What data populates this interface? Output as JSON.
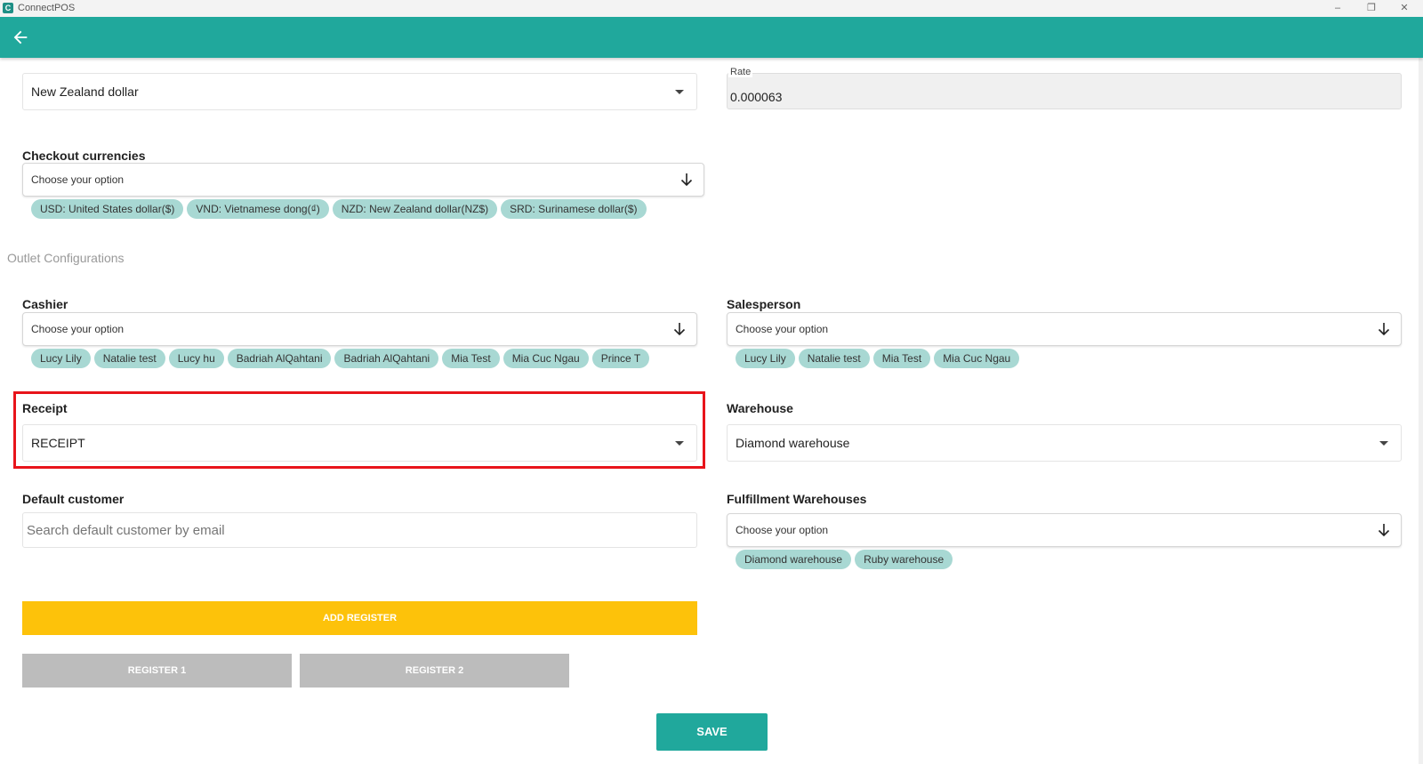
{
  "window": {
    "title": "ConnectPOS",
    "logo_letter": "C",
    "minimize": "–",
    "restore": "❐",
    "close": "✕"
  },
  "header": {
    "back_icon": "arrow-left-icon"
  },
  "currency": {
    "selected": "New Zealand dollar",
    "rate_label": "Rate",
    "rate_value": "0.000063"
  },
  "checkout_currencies": {
    "label": "Checkout currencies",
    "placeholder": "Choose your option",
    "chips": [
      "USD: United States dollar($)",
      "VND: Vietnamese dong(₫)",
      "NZD: New Zealand dollar(NZ$)",
      "SRD: Surinamese dollar($)"
    ]
  },
  "outlet_section": {
    "title": "Outlet Configurations"
  },
  "cashier": {
    "label": "Cashier",
    "placeholder": "Choose your option",
    "chips": [
      "Lucy Lily",
      "Natalie test",
      "Lucy hu",
      "Badriah  AlQahtani",
      "Badriah  AlQahtani",
      "Mia Test",
      "Mia Cuc Ngau",
      "Prince T"
    ]
  },
  "salesperson": {
    "label": "Salesperson",
    "placeholder": "Choose your option",
    "chips": [
      "Lucy Lily",
      "Natalie test",
      "Mia Test",
      "Mia Cuc Ngau"
    ]
  },
  "receipt": {
    "label": "Receipt",
    "selected": "RECEIPT",
    "highlight_color": "#e8141b"
  },
  "warehouse": {
    "label": "Warehouse",
    "selected": "Diamond warehouse"
  },
  "default_customer": {
    "label": "Default customer",
    "placeholder": "Search default customer by email"
  },
  "fulfillment": {
    "label": "Fulfillment Warehouses",
    "placeholder": "Choose your option",
    "chips": [
      "Diamond warehouse",
      "Ruby warehouse"
    ]
  },
  "actions": {
    "add_register": "ADD REGISTER",
    "registers": [
      "REGISTER 1",
      "REGISTER 2"
    ],
    "save": "SAVE"
  },
  "colors": {
    "primary": "#20a89c",
    "accent_yellow": "#fdc20a",
    "chip": "#a8d8d3",
    "register_gray": "#bcbcbc",
    "save": "#20a89c"
  }
}
